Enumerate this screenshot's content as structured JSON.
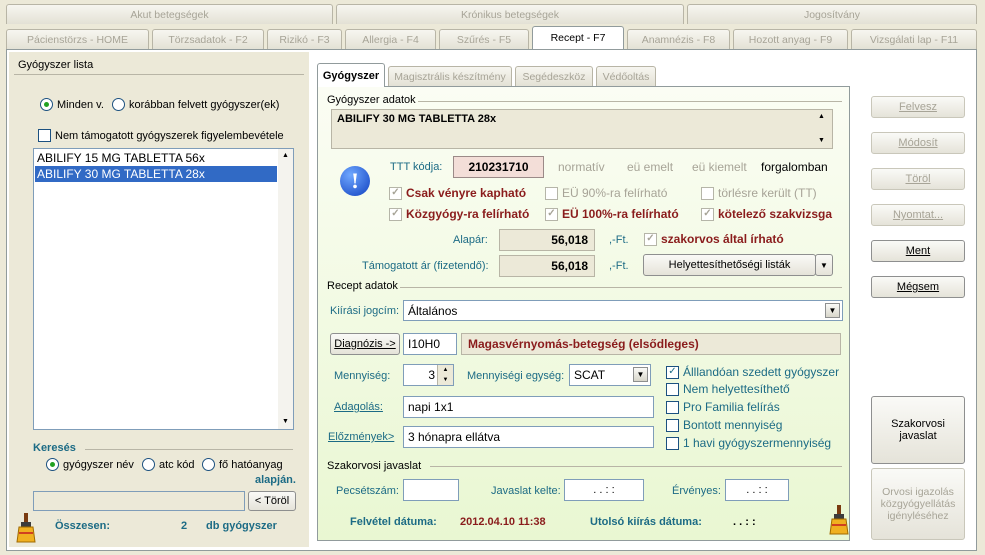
{
  "top_tabs": [
    "Akut betegségek",
    "Krónikus betegségek",
    "Jogosítvány"
  ],
  "main_tabs": [
    "Pácienstörzs - HOME",
    "Törzsadatok - F2",
    "Rizikó - F3",
    "Allergia - F4",
    "Szűrés - F5",
    "Recept - F7",
    "Anamnézis - F8",
    "Hozott anyag - F9",
    "Vizsgálati lap - F11"
  ],
  "left": {
    "title": "Gyógyszer lista",
    "radio_all": "Minden v.",
    "radio_prev": "korábban felvett gyógyszer(ek)",
    "chk_unsupported": "Nem támogatott gyógyszerek figyelembevétele",
    "list": [
      "ABILIFY 15 MG TABLETTA 56x",
      "ABILIFY 30 MG TABLETTA 28x"
    ],
    "search_title": "Keresés",
    "search_opts": [
      "gyógyszer név",
      "atc kód",
      "fő hatóanyag"
    ],
    "search_suffix": "alapján.",
    "clear_btn": "< Töröl",
    "total_label": "Összesen:",
    "total_count": "2",
    "total_unit": "db gyógyszer"
  },
  "subtabs": [
    "Gyógyszer",
    "Magisztrális készítmény",
    "Segédeszköz",
    "Védőoltás"
  ],
  "drug": {
    "section": "Gyógyszer adatok",
    "name": "ABILIFY 30 MG TABLETTA 28x",
    "ttt_label": "TTT kódja:",
    "ttt_code": "210231710",
    "flags": [
      "normatív",
      "eü emelt",
      "eü kiemelt",
      "forgalomban"
    ],
    "c1": "Csak vényre kapható",
    "c2": "EÜ 90%-ra felírható",
    "c3": "törlésre került (TT)",
    "c4": "Közgyógy-ra felírható",
    "c5": "EÜ 100%-ra felírható",
    "c6": "kötelező szakvizsga",
    "alapar_label": "Alapár:",
    "alapar": "56,018",
    "currency": ",-Ft.",
    "c7": "szakorvos által írható",
    "tam_label": "Támogatott ár (fizetendő):",
    "tam": "56,018",
    "helyettesit_btn": "Helyettesíthetőségi listák"
  },
  "recept": {
    "section": "Recept adatok",
    "jogcim_label": "Kiírási jogcím:",
    "jogcim": "Általános",
    "diag_btn": "Diagnózis ->",
    "diag_code": "I10H0",
    "diag_text": "Magasvérnyomás-betegség (elsődleges)",
    "menny_label": "Mennyiség:",
    "menny": "3",
    "egyseg_label": "Mennyiségi egység:",
    "egyseg": "SCAT",
    "adag_label": "Adagolás:",
    "adag": "napi 1x1",
    "elozm_label": "Előzmények>",
    "elozm": "3 hónapra ellátva",
    "chks": [
      "Álllandóan szedett gyógyszer",
      "Nem helyettesíthető",
      "Pro Familia felírás",
      "Bontott mennyiség",
      "1 havi gyógyszermennyiség"
    ]
  },
  "szak": {
    "section": "Szakorvosi javaslat",
    "pecset": "Pecsétszám:",
    "kelte": "Javaslat kelte:",
    "ervenyes": "Érvényes:",
    "date_mask": ". .   : :",
    "felvetel_label": "Felvétel dátuma:",
    "felvetel": "2012.04.10 11:38",
    "utolso_label": "Utolsó kiírás dátuma:",
    "utolso": ". .   : :"
  },
  "right": {
    "felvesz": "Felvesz",
    "modosit": "Módosít",
    "torol": "Töröl",
    "nyomtat": "Nyomtat...",
    "ment": "Ment",
    "megsem": "Mégsem",
    "szakorvosi": "Szakorvosi javaslat",
    "orvosi": "Orvosi igazolás közgyógyellátás igényléséhez"
  }
}
